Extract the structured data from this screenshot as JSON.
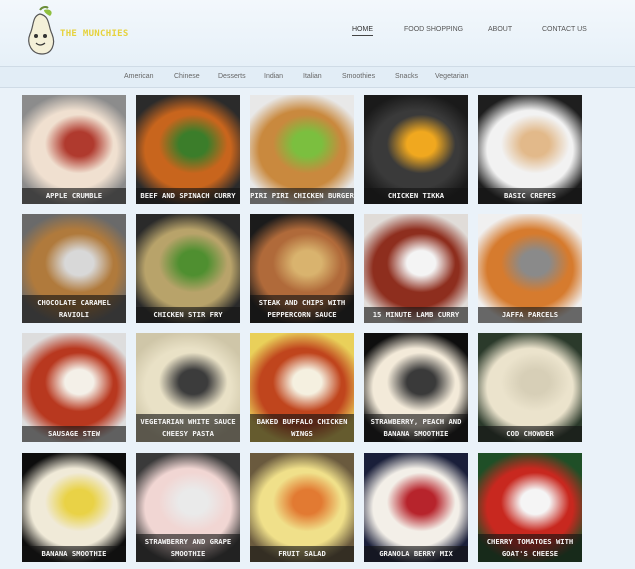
{
  "brand": {
    "name": "THE MUNCHIES",
    "logo_icon": "pear-mascot-icon"
  },
  "nav": {
    "items": [
      {
        "label": "HOME",
        "active": true
      },
      {
        "label": "FOOD SHOPPING",
        "active": false
      },
      {
        "label": "ABOUT",
        "active": false
      },
      {
        "label": "CONTACT US",
        "active": false
      }
    ]
  },
  "categories": [
    "American",
    "Chinese",
    "Desserts",
    "Indian",
    "Italian",
    "Smoothies",
    "Snacks",
    "Vegetarian"
  ],
  "recipes": [
    {
      "title": "Apple Crumble",
      "colors": [
        "#8c8c8c",
        "#f0e0d0",
        "#b03a2e"
      ]
    },
    {
      "title": "Beef and Spinach Curry",
      "colors": [
        "#2b2b2b",
        "#c8651d",
        "#3b7d2a"
      ]
    },
    {
      "title": "Piri Piri Chicken Burger",
      "colors": [
        "#e8e8e8",
        "#c9893e",
        "#7bbf3f"
      ]
    },
    {
      "title": "Chicken Tikka",
      "colors": [
        "#1a1a1a",
        "#3a3a3a",
        "#f0a81f"
      ]
    },
    {
      "title": "Basic Crepes",
      "colors": [
        "#1e1e1e",
        "#f2f2f2",
        "#e2b98a"
      ]
    },
    {
      "title": "Chocolate Caramel Ravioli",
      "colors": [
        "#6a6a6a",
        "#b07a3c",
        "#d8d8d8"
      ]
    },
    {
      "title": "Chicken Stir Fry",
      "colors": [
        "#2a2a2a",
        "#b8a36a",
        "#4f8f30"
      ]
    },
    {
      "title": "Steak and Chips with Peppercorn Sauce",
      "colors": [
        "#1b1b1b",
        "#b06a3a",
        "#d9b36e"
      ]
    },
    {
      "title": "15 Minute Lamb Curry",
      "colors": [
        "#e0dcd8",
        "#8e2e1e",
        "#f4f4f4"
      ]
    },
    {
      "title": "Jaffa Parcels",
      "colors": [
        "#f0f0f0",
        "#d67b2e",
        "#8a8a8a"
      ]
    },
    {
      "title": "Sausage Stew",
      "colors": [
        "#dddddd",
        "#b8381f",
        "#f4f0e8"
      ]
    },
    {
      "title": "Vegetarian White Sauce Cheesy Pasta",
      "colors": [
        "#cfc6a8",
        "#e9e1c6",
        "#3c3c3c"
      ]
    },
    {
      "title": "Baked Buffalo Chicken Wings",
      "colors": [
        "#e9d05a",
        "#c0451d",
        "#f5f0e0"
      ]
    },
    {
      "title": "Strawberry, Peach and Banana Smoothie",
      "colors": [
        "#0e0e0e",
        "#f3ead9",
        "#3a3a3a"
      ]
    },
    {
      "title": "Cod Chowder",
      "colors": [
        "#2b3a2b",
        "#ebe3cc",
        "#d7cfb7"
      ]
    },
    {
      "title": "Banana Smoothie",
      "colors": [
        "#0d0d0d",
        "#f0ead8",
        "#e9d246"
      ]
    },
    {
      "title": "Strawberry and Grape Smoothie",
      "colors": [
        "#3a3a3a",
        "#f1d6d3",
        "#eaeaea"
      ]
    },
    {
      "title": "Fruit Salad",
      "colors": [
        "#6a5a3e",
        "#f0e08a",
        "#e27a32"
      ]
    },
    {
      "title": "Granola Berry Mix",
      "colors": [
        "#1a1f3a",
        "#f3efe8",
        "#b7242c"
      ]
    },
    {
      "title": "Cherry Tomatoes with Goat's Cheese",
      "colors": [
        "#1f4f27",
        "#c8281f",
        "#f5f5f5"
      ]
    }
  ]
}
